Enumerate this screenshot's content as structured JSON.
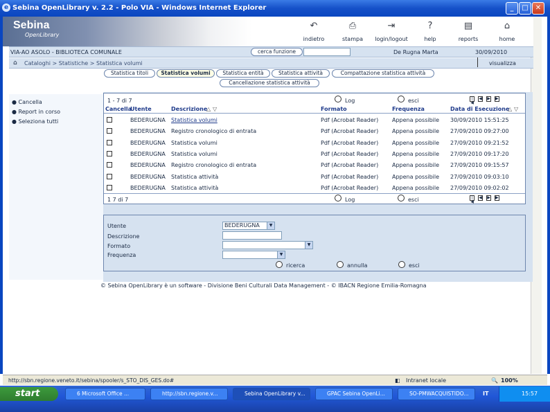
{
  "window": {
    "title": "Sebina OpenLibrary v. 2.2 - Polo VIA - Windows Internet Explorer"
  },
  "banner": {
    "logo_title": "Sebina",
    "logo_sub": "OpenLibrary",
    "nav": [
      {
        "label": "indietro",
        "icon": "back-icon"
      },
      {
        "label": "stampa",
        "icon": "print-icon"
      },
      {
        "label": "login/logout",
        "icon": "login-icon"
      },
      {
        "label": "help",
        "icon": "help-icon"
      },
      {
        "label": "reports",
        "icon": "reports-icon"
      },
      {
        "label": "home",
        "icon": "home-icon"
      }
    ]
  },
  "infobar": {
    "library": "VIA-AO ASOLO - BIBLIOTECA COMUNALE",
    "search_button": "cerca funzione",
    "user": "De Rugna Marta",
    "date": "30/09/2010"
  },
  "breadcrumb": {
    "text": "Cataloghi > Statistiche > Statistica volumi",
    "view": "visualizza"
  },
  "tabs": [
    "Statistica titoli",
    "Statistica volumi",
    "Statistica entità",
    "Statistica attività",
    "Compattazione statistica attività",
    "Cancellazione statistica attività"
  ],
  "side": {
    "items": [
      "Cancella",
      "Report in corso",
      "Seleziona tutti"
    ]
  },
  "list": {
    "page_text": "1 - 7  di  7",
    "footer_page": "1   7  di  7",
    "log": "Log",
    "exit": "esci",
    "headers": [
      "Cancella",
      "Utente",
      "Descrizione",
      "Formato",
      "Frequenza",
      "Data di Esecuzione"
    ],
    "rows": [
      {
        "user": "BEDERUGNA",
        "desc": "Statistica volumi",
        "format": "Pdf (Acrobat Reader)",
        "freq": "Appena possibile",
        "date": "30/09/2010 15:51:25"
      },
      {
        "user": "BEDERUGNA",
        "desc": "Registro cronologico di entrata",
        "format": "Pdf (Acrobat Reader)",
        "freq": "Appena possibile",
        "date": "27/09/2010 09:27:00"
      },
      {
        "user": "BEDERUGNA",
        "desc": "Statistica volumi",
        "format": "Pdf (Acrobat Reader)",
        "freq": "Appena possibile",
        "date": "27/09/2010 09:21:52"
      },
      {
        "user": "BEDERUGNA",
        "desc": "Statistica volumi",
        "format": "Pdf (Acrobat Reader)",
        "freq": "Appena possibile",
        "date": "27/09/2010 09:17:20"
      },
      {
        "user": "BEDERUGNA",
        "desc": "Registro cronologico di entrata",
        "format": "Pdf (Acrobat Reader)",
        "freq": "Appena possibile",
        "date": "27/09/2010 09:15:57"
      },
      {
        "user": "BEDERUGNA",
        "desc": "Statistica attività",
        "format": "Pdf (Acrobat Reader)",
        "freq": "Appena possibile",
        "date": "27/09/2010 09:03:10"
      },
      {
        "user": "BEDERUGNA",
        "desc": "Statistica attività",
        "format": "Pdf (Acrobat Reader)",
        "freq": "Appena possibile",
        "date": "27/09/2010 09:02:02"
      }
    ]
  },
  "form": {
    "labels": [
      "Utente",
      "Descrizione",
      "Formato",
      "Frequenza"
    ],
    "utente_value": "BEDERUGNA",
    "ricerca": "ricerca",
    "annulla": "annulla",
    "esci": "esci"
  },
  "footer": {
    "text": "© Sebina OpenLibrary è un software - Divisione Beni Culturali Data Management - © IBACN Regione Emilia-Romagna"
  },
  "statusbar": {
    "url": "http://sbn.regione.veneto.it/sebina/spooler/s_STO_DIS_GES.do#",
    "zone": "Intranet locale",
    "zoom": "100%"
  },
  "taskbar": {
    "start": "start",
    "tasks": [
      "6 Microsoft Office ...",
      "http://sbn.regione.v...",
      "Sebina OpenLibrary v...",
      "GPAC Sebina OpenLi...",
      "SO-PMWACQUISTIDO..."
    ],
    "lang": "IT",
    "clock": "15:57"
  }
}
